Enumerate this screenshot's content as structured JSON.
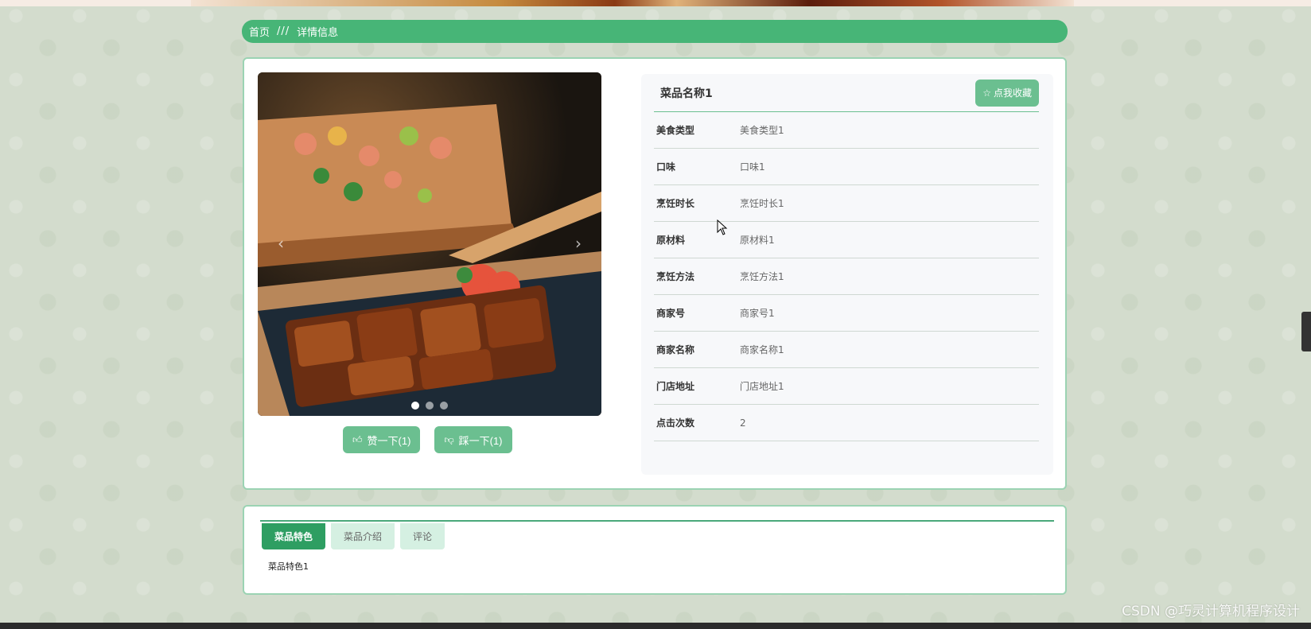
{
  "breadcrumb": {
    "home": "首页",
    "separator": "///",
    "current": "详情信息"
  },
  "product": {
    "name": "菜品名称1",
    "favorite_label": "点我收藏",
    "favorite_icon": "star-outline-icon"
  },
  "details": [
    {
      "label": "美食类型",
      "value": "美食类型1"
    },
    {
      "label": "口味",
      "value": "口味1"
    },
    {
      "label": "烹饪时长",
      "value": "烹饪时长1"
    },
    {
      "label": "原材料",
      "value": "原材料1"
    },
    {
      "label": "烹饪方法",
      "value": "烹饪方法1"
    },
    {
      "label": "商家号",
      "value": "商家号1"
    },
    {
      "label": "商家名称",
      "value": "商家名称1"
    },
    {
      "label": "门店地址",
      "value": "门店地址1"
    },
    {
      "label": "点击次数",
      "value": "2"
    }
  ],
  "carousel": {
    "slides": 3,
    "active_index": 0
  },
  "votes": {
    "like_label": "赞一下(1)",
    "dislike_label": "踩一下(1)",
    "like_icon": "thumbs-up-icon",
    "dislike_icon": "thumbs-down-icon"
  },
  "tabs": [
    {
      "label": "菜品特色",
      "active": true
    },
    {
      "label": "菜品介绍",
      "active": false
    },
    {
      "label": "评论",
      "active": false
    }
  ],
  "tab_content": "菜品特色1",
  "watermark": "CSDN @巧灵计算机程序设计",
  "colors": {
    "accent": "#47b577",
    "button": "#6bbf90",
    "tab_active": "#2e9e62",
    "tab_inactive": "#d5f0e2",
    "background": "#d3dccd"
  }
}
